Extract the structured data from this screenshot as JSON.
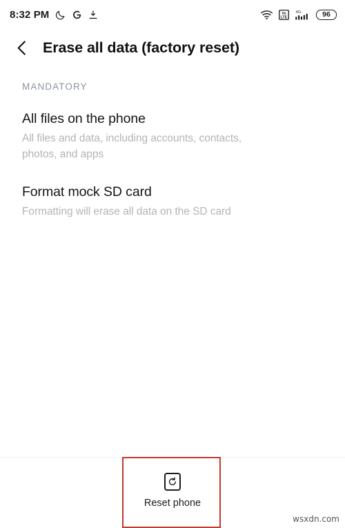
{
  "status_bar": {
    "time": "8:32 PM",
    "left_icons": [
      {
        "name": "moon-icon",
        "label": "Do not disturb"
      },
      {
        "name": "google-icon",
        "label": "G"
      },
      {
        "name": "download-icon",
        "label": "Download"
      }
    ],
    "right_icons": [
      {
        "name": "wifi-icon",
        "label": "Wi-Fi"
      },
      {
        "name": "volte-icon",
        "label": "VoLTE"
      },
      {
        "name": "signal-icon",
        "label": "4G"
      }
    ],
    "network_type": "4G",
    "volte_top": "Vo",
    "volte_bottom": "LTE",
    "battery_percent": "96"
  },
  "header": {
    "back_label": "Back",
    "title": "Erase all data (factory reset)"
  },
  "main": {
    "section_label": "MANDATORY",
    "items": [
      {
        "title": "All files on the phone",
        "subtitle": "All files and data, including accounts, contacts, photos, and apps"
      },
      {
        "title": "Format mock SD card",
        "subtitle": "Formatting will erase all data on the SD card"
      }
    ]
  },
  "bottom_bar": {
    "reset_label": "Reset phone",
    "reset_icon": "reset-phone-icon"
  },
  "annotation": {
    "color": "#c0392b",
    "target": "reset-phone-button"
  },
  "watermark": {
    "text": "wsxdn.com"
  }
}
